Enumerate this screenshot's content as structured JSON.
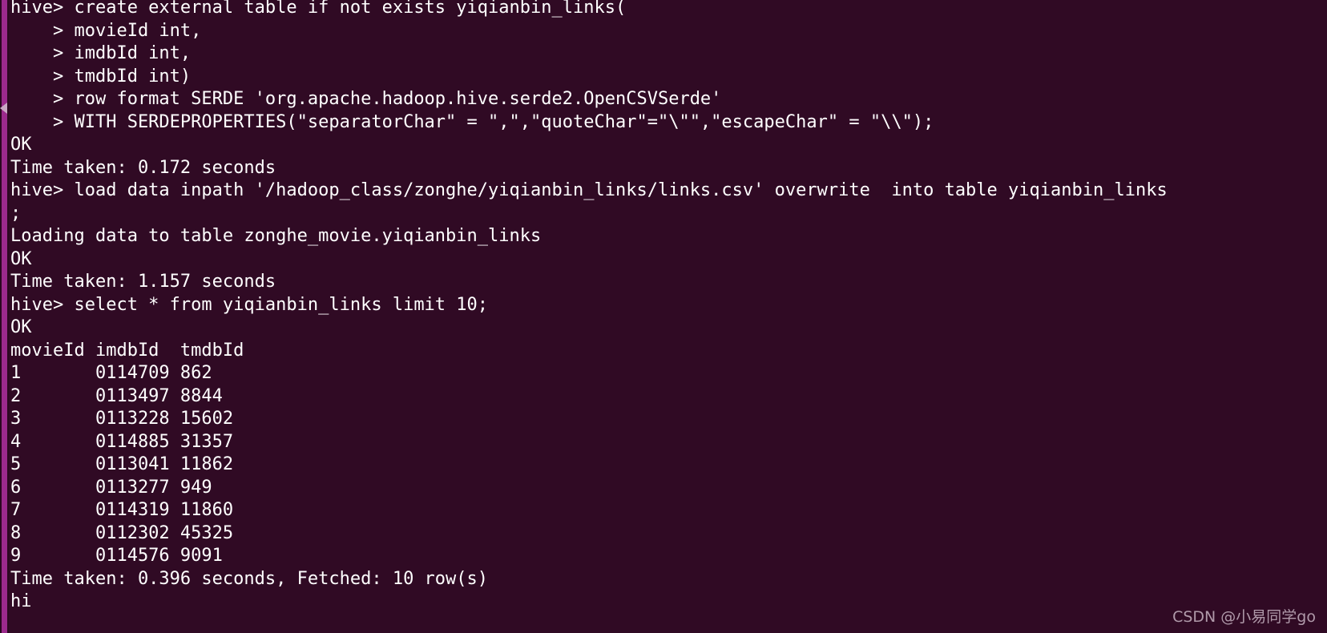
{
  "terminal": {
    "app": "hive-cli-terminal",
    "background_color": "#300a24",
    "text_color": "#ffffff",
    "scrollbar_color": "#9b2a8c",
    "watermark": "CSDN @小易同学go",
    "lines": [
      "hive> create external table if not exists yiqianbin_links(",
      "    > movieId int,",
      "    > imdbId int,",
      "    > tmdbId int)",
      "    > row format SERDE 'org.apache.hadoop.hive.serde2.OpenCSVSerde'",
      "    > WITH SERDEPROPERTIES(\"separatorChar\" = \",\",\"quoteChar\"=\"\\\"\",\"escapeChar\" = \"\\\\\");",
      "OK",
      "Time taken: 0.172 seconds",
      "hive> load data inpath '/hadoop_class/zonghe/yiqianbin_links/links.csv' overwrite  into table yiqianbin_links",
      ";",
      "Loading data to table zonghe_movie.yiqianbin_links",
      "OK",
      "Time taken: 1.157 seconds",
      "hive> select * from yiqianbin_links limit 10;",
      "OK",
      "movieId\timdbId\ttmdbId",
      "1\t0114709\t862",
      "2\t0113497\t8844",
      "3\t0113228\t15602",
      "4\t0114885\t31357",
      "5\t0113041\t11862",
      "6\t0113277\t949",
      "7\t0114319\t11860",
      "8\t0112302\t45325",
      "9\t0114576\t9091",
      "Time taken: 0.396 seconds, Fetched: 10 row(s)",
      "hi"
    ],
    "query_result": {
      "columns": [
        "movieId",
        "imdbId",
        "tmdbId"
      ],
      "rows": [
        [
          "1",
          "0114709",
          "862"
        ],
        [
          "2",
          "0113497",
          "8844"
        ],
        [
          "3",
          "0113228",
          "15602"
        ],
        [
          "4",
          "0114885",
          "31357"
        ],
        [
          "5",
          "0113041",
          "11862"
        ],
        [
          "6",
          "0113277",
          "949"
        ],
        [
          "7",
          "0114319",
          "11860"
        ],
        [
          "8",
          "0112302",
          "45325"
        ],
        [
          "9",
          "0114576",
          "9091"
        ]
      ],
      "fetched_rows": "10",
      "time_taken": "0.396 seconds"
    }
  }
}
